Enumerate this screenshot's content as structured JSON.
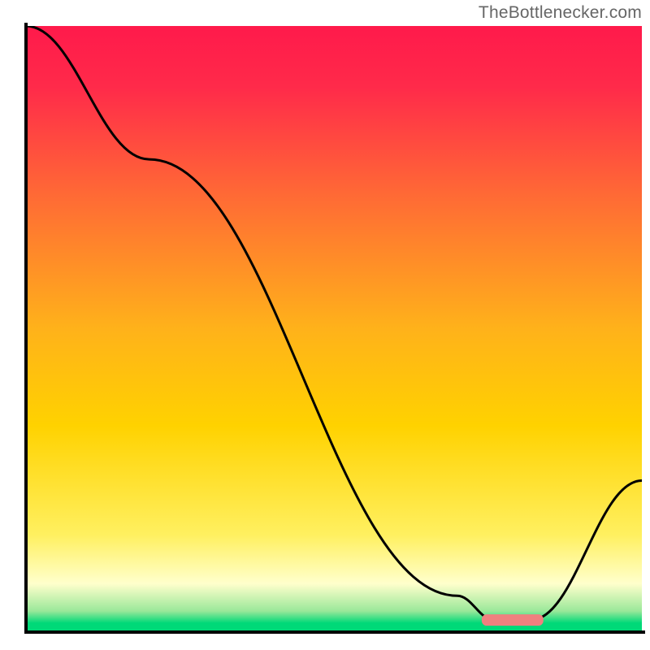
{
  "watermark": "TheBottlenecker.com",
  "chart_data": {
    "type": "line",
    "title": "",
    "xlabel": "",
    "ylabel": "",
    "xlim": [
      0,
      100
    ],
    "ylim": [
      0,
      100
    ],
    "background": {
      "top_color": "#ff1a4b",
      "mid_color": "#ffd200",
      "low_color": "#ffffcc",
      "bottom_color": "#00d978"
    },
    "series": [
      {
        "name": "bottleneck-curve",
        "x": [
          0,
          20,
          70,
          76,
          82,
          100
        ],
        "values": [
          100,
          78,
          6,
          2,
          2,
          25
        ]
      }
    ],
    "marker": {
      "name": "optimal-range",
      "x_start": 74,
      "x_end": 84,
      "y": 2,
      "color": "#f0807f"
    },
    "axes_color": "#000000",
    "axes_width": 4
  }
}
